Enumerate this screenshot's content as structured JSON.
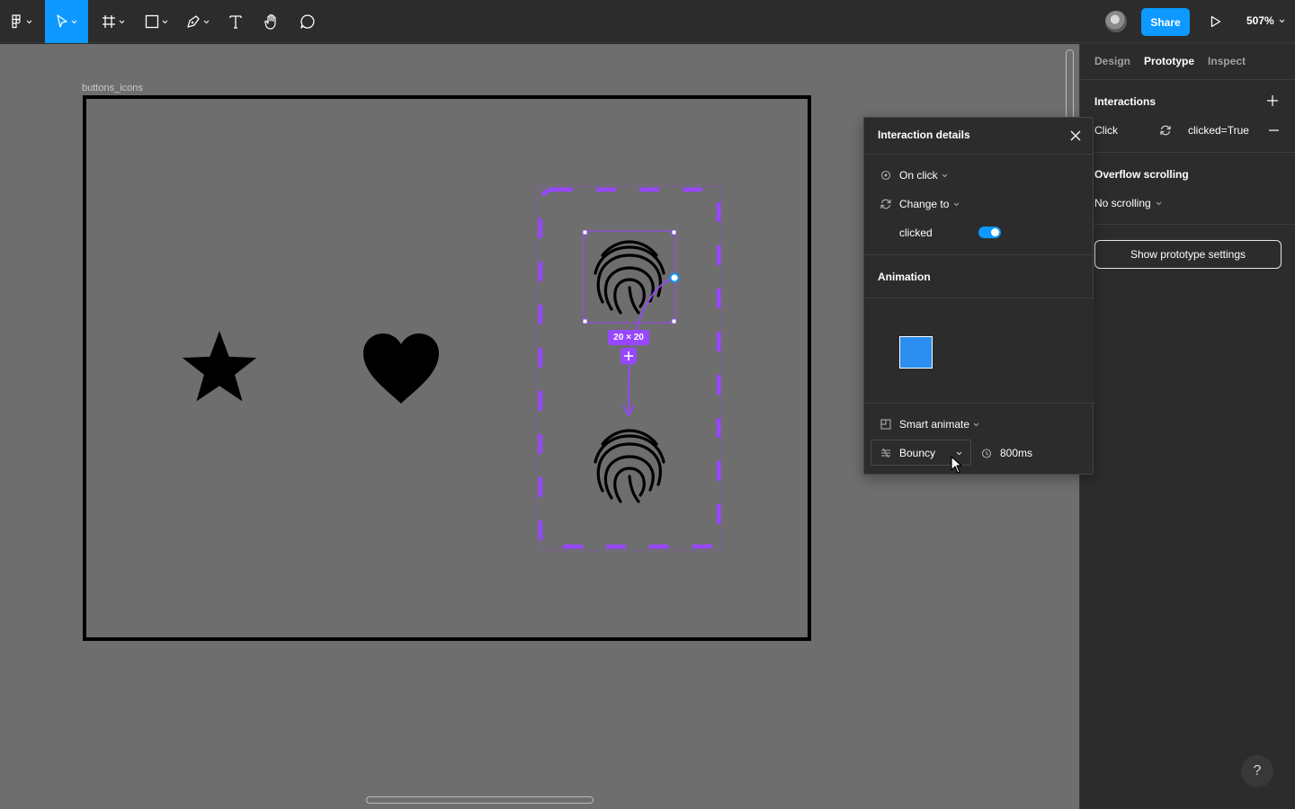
{
  "toolbar": {
    "tools": [
      {
        "name": "main-menu",
        "icon": "figma-logo-icon"
      },
      {
        "name": "move-tool",
        "icon": "move-arrow-icon",
        "active": true
      },
      {
        "name": "frame-tool",
        "icon": "frame-hash-icon"
      },
      {
        "name": "shape-tool",
        "icon": "rectangle-icon"
      },
      {
        "name": "pen-tool",
        "icon": "pen-icon"
      },
      {
        "name": "text-tool",
        "icon": "text-icon"
      },
      {
        "name": "hand-tool",
        "icon": "hand-icon"
      },
      {
        "name": "comment-tool",
        "icon": "comment-icon"
      }
    ],
    "share_label": "Share",
    "zoom_label": "507%",
    "accent_color": "#0d99ff"
  },
  "canvas": {
    "frame_label": "buttons_icons",
    "size_label": "20 × 20",
    "selection_color": "#9747ff"
  },
  "right_panel": {
    "tabs": [
      {
        "label": "Design",
        "active": false
      },
      {
        "label": "Prototype",
        "active": true
      },
      {
        "label": "Inspect",
        "active": false
      }
    ],
    "interactions_title": "Interactions",
    "interaction": {
      "trigger": "Click",
      "action": "clicked=True"
    },
    "overflow_title": "Overflow scrolling",
    "overflow_value": "No scrolling",
    "show_settings_label": "Show prototype settings",
    "help_label": "?"
  },
  "popover": {
    "title": "Interaction details",
    "trigger_label": "On click",
    "action_label": "Change to",
    "property_label": "clicked",
    "property_on": true,
    "animation_title": "Animation",
    "animation_type": "Smart animate",
    "easing": "Bouncy",
    "duration": "800ms"
  }
}
